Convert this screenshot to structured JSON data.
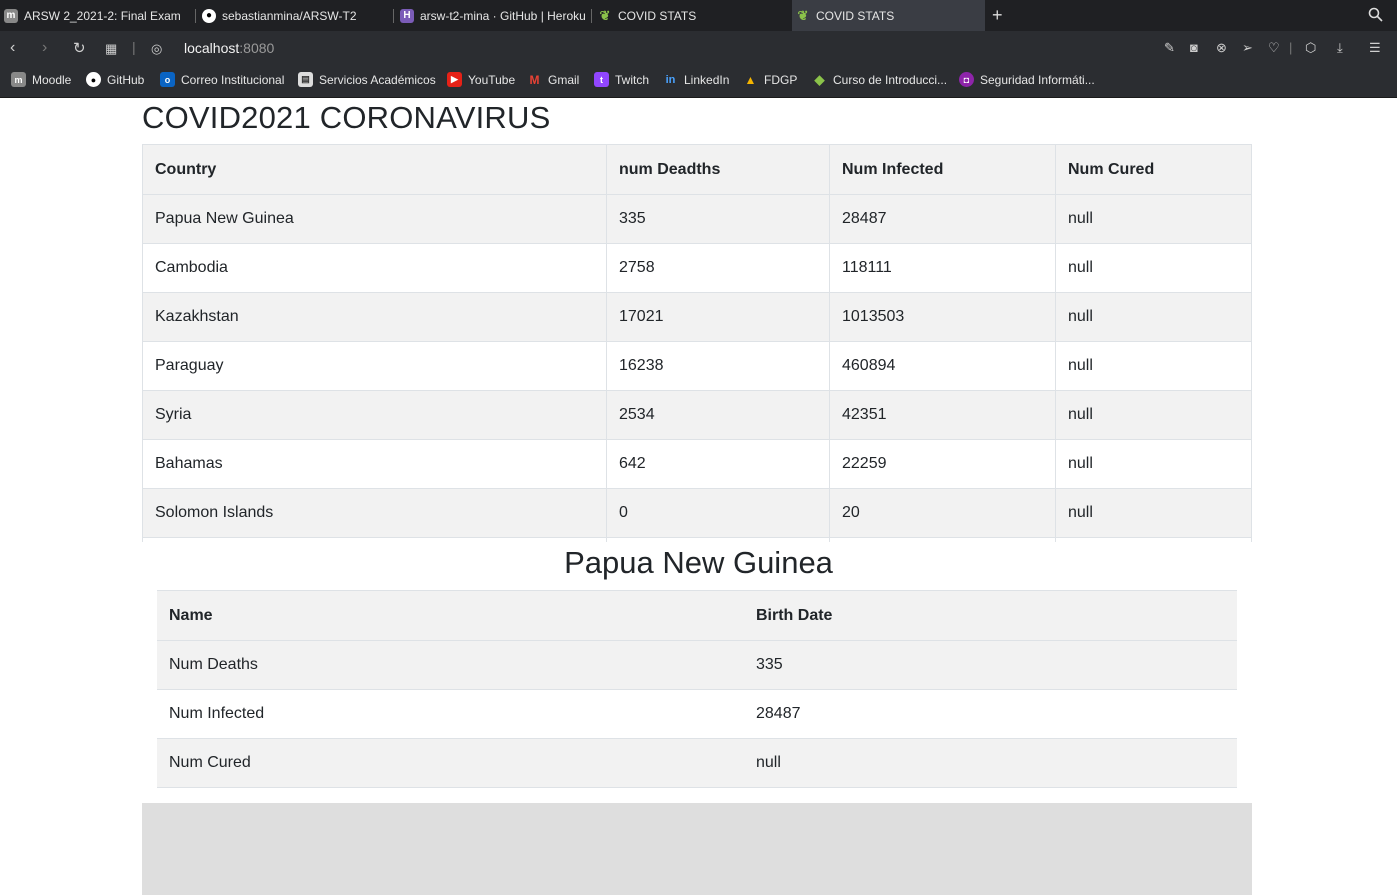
{
  "browser": {
    "tabs": [
      {
        "label": "ARSW 2_2021-2: Final Exam",
        "icon": "moodle-icon"
      },
      {
        "label": "sebastianmina/ARSW-T2",
        "icon": "github-icon"
      },
      {
        "label": "arsw-t2-mina · GitHub | Heroku",
        "icon": "heroku-icon"
      },
      {
        "label": "COVID STATS",
        "icon": "spring-leaf-icon"
      },
      {
        "label": "COVID STATS",
        "icon": "spring-leaf-icon"
      }
    ],
    "url_host": "localhost",
    "url_port": ":8080",
    "bookmarks": [
      {
        "label": "Moodle",
        "icon": "moodle-icon"
      },
      {
        "label": "GitHub",
        "icon": "github-icon"
      },
      {
        "label": "Correo Institucional",
        "icon": "outlook-icon"
      },
      {
        "label": "Servicios Académicos",
        "icon": "document-icon"
      },
      {
        "label": "YouTube",
        "icon": "youtube-icon"
      },
      {
        "label": "Gmail",
        "icon": "gmail-icon"
      },
      {
        "label": "Twitch",
        "icon": "twitch-icon"
      },
      {
        "label": "LinkedIn",
        "icon": "linkedin-icon"
      },
      {
        "label": "FDGP",
        "icon": "drive-icon"
      },
      {
        "label": "Curso de Introducci...",
        "icon": "diamond-icon"
      },
      {
        "label": "Seguridad Informáti...",
        "icon": "shield-icon"
      }
    ]
  },
  "page": {
    "title": "COVID2021 CORONAVIRUS",
    "table": {
      "headers": [
        "Country",
        "num Deadths",
        "Num Infected",
        "Num Cured"
      ],
      "rows": [
        [
          "Papua New Guinea",
          "335",
          "28487",
          "null"
        ],
        [
          "Cambodia",
          "2758",
          "118111",
          "null"
        ],
        [
          "Kazakhstan",
          "17021",
          "1013503",
          "null"
        ],
        [
          "Paraguay",
          "16238",
          "460894",
          "null"
        ],
        [
          "Syria",
          "2534",
          "42351",
          "null"
        ],
        [
          "Bahamas",
          "642",
          "22259",
          "null"
        ],
        [
          "Solomon Islands",
          "0",
          "20",
          "null"
        ]
      ]
    },
    "detail": {
      "title": "Papua New Guinea",
      "headers": [
        "Name",
        "Birth Date"
      ],
      "rows": [
        [
          "Num Deaths",
          "335"
        ],
        [
          "Num Infected",
          "28487"
        ],
        [
          "Num Cured",
          "null"
        ]
      ]
    }
  }
}
